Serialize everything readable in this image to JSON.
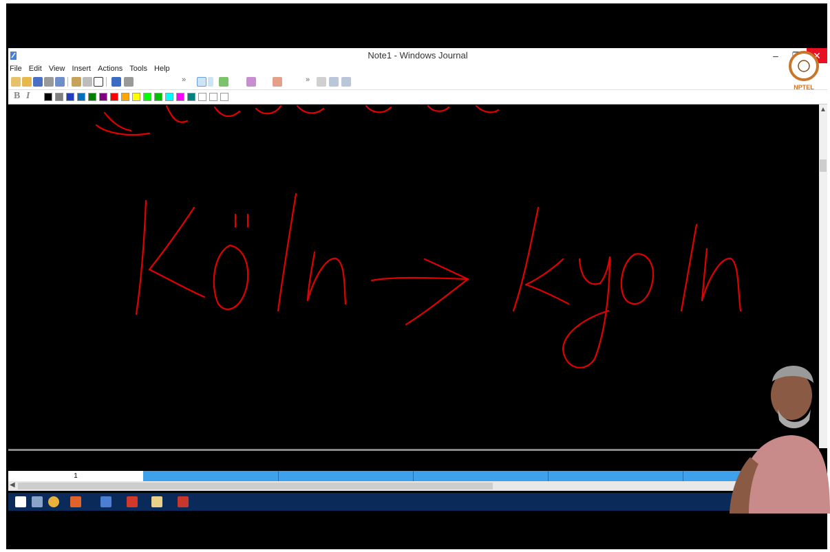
{
  "window": {
    "title": "Note1 - Windows Journal"
  },
  "menu": [
    "File",
    "Edit",
    "View",
    "Insert",
    "Actions",
    "Tools",
    "Help"
  ],
  "toolbar": {
    "chevron": "»"
  },
  "format": {
    "bold": "B",
    "italic": "I"
  },
  "palette": [
    "#000000",
    "#808080",
    "#1f3fbf",
    "#0070c0",
    "#008000",
    "#800080",
    "#ff0000",
    "#ffa500",
    "#ffff00",
    "#00ff00",
    "#00c000",
    "#00ffff",
    "#ff00ff",
    "#008080",
    "#ffffff",
    "#ffffff",
    "#ffffff"
  ],
  "handwriting": {
    "text": "Köln → kyoln",
    "color": "#e10000"
  },
  "page_tabs": {
    "current": "1"
  },
  "watermark": {
    "logo_text": "NPTEL"
  }
}
